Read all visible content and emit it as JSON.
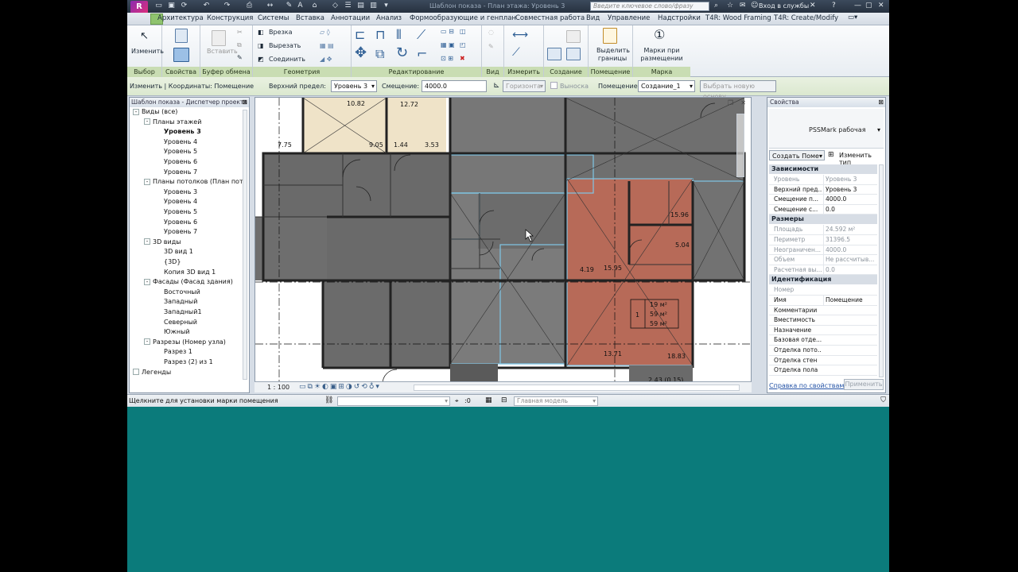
{
  "title_bar": {
    "document_title": "Шаблон показа - План этажа: Уровень 3",
    "search_placeholder": "Введите ключевое слово/фразу",
    "login_label": "Вход в службы"
  },
  "menu_tabs": [
    "Архитектура",
    "Конструкция",
    "Системы",
    "Вставка",
    "Аннотации",
    "Анализ",
    "Формообразующие и генплан",
    "Совместная работа",
    "Вид",
    "Управление",
    "Надстройки",
    "T4R: Wood Framing",
    "T4R: Create/Modify"
  ],
  "ribbon": {
    "panels": {
      "select": "Выбор",
      "properties": "Свойства",
      "clipboard": "Буфер обмена",
      "geometry": "Геометрия",
      "edit": "Редактирование",
      "view": "Вид",
      "measure": "Измерить",
      "create": "Создание",
      "room": "Помещение",
      "tag": "Марка"
    },
    "buttons": {
      "modify": "Изменить",
      "paste": "Вставить",
      "cut_join": "Врезка",
      "cut": "Вырезать",
      "join": "Соединить",
      "highlight_bounds": "Выделить границы",
      "tags_on_placement": "Марки при размещении"
    }
  },
  "options_bar": {
    "context": "Изменить | Координаты: Помещение",
    "upper_limit_label": "Верхний предел:",
    "upper_limit_value": "Уровень 3",
    "offset_label": "Смещение:",
    "offset_value": "4000.0",
    "orientation_value": "Горизонта",
    "leader_label": "Выноска",
    "room_label": "Помещение:",
    "room_value": "Создание_1",
    "pick_boundary_button": "Выбрать новую основу"
  },
  "project_browser": {
    "title": "Шаблон показа - Диспетчер проекта",
    "items": [
      {
        "label": "Виды (все)",
        "level": 0,
        "toggle": "-",
        "bold": false
      },
      {
        "label": "Планы этажей",
        "level": 1,
        "toggle": "-",
        "bold": false
      },
      {
        "label": "Уровень 3",
        "level": 2,
        "toggle": "",
        "bold": true
      },
      {
        "label": "Уровень 4",
        "level": 2,
        "toggle": "",
        "bold": false
      },
      {
        "label": "Уровень 5",
        "level": 2,
        "toggle": "",
        "bold": false
      },
      {
        "label": "Уровень 6",
        "level": 2,
        "toggle": "",
        "bold": false
      },
      {
        "label": "Уровень 7",
        "level": 2,
        "toggle": "",
        "bold": false
      },
      {
        "label": "Планы потолков (План пот",
        "level": 1,
        "toggle": "-",
        "bold": false
      },
      {
        "label": "Уровень 3",
        "level": 2,
        "toggle": "",
        "bold": false
      },
      {
        "label": "Уровень 4",
        "level": 2,
        "toggle": "",
        "bold": false
      },
      {
        "label": "Уровень 5",
        "level": 2,
        "toggle": "",
        "bold": false
      },
      {
        "label": "Уровень 6",
        "level": 2,
        "toggle": "",
        "bold": false
      },
      {
        "label": "Уровень 7",
        "level": 2,
        "toggle": "",
        "bold": false
      },
      {
        "label": "3D виды",
        "level": 1,
        "toggle": "-",
        "bold": false
      },
      {
        "label": "3D вид 1",
        "level": 2,
        "toggle": "",
        "bold": false
      },
      {
        "label": "{3D}",
        "level": 2,
        "toggle": "",
        "bold": false
      },
      {
        "label": "Копия 3D вид 1",
        "level": 2,
        "toggle": "",
        "bold": false
      },
      {
        "label": "Фасады (Фасад здания)",
        "level": 1,
        "toggle": "-",
        "bold": false
      },
      {
        "label": "Восточный",
        "level": 2,
        "toggle": "",
        "bold": false
      },
      {
        "label": "Западный",
        "level": 2,
        "toggle": "",
        "bold": false
      },
      {
        "label": "Западный1",
        "level": 2,
        "toggle": "",
        "bold": false
      },
      {
        "label": "Северный",
        "level": 2,
        "toggle": "",
        "bold": false
      },
      {
        "label": "Южный",
        "level": 2,
        "toggle": "",
        "bold": false
      },
      {
        "label": "Разрезы (Номер узла)",
        "level": 1,
        "toggle": "-",
        "bold": false
      },
      {
        "label": "Разрез 1",
        "level": 2,
        "toggle": "",
        "bold": false
      },
      {
        "label": "Разрез (2) из 1",
        "level": 2,
        "toggle": "",
        "bold": false
      },
      {
        "label": "Легенды",
        "level": 0,
        "toggle": "",
        "bold": false
      }
    ]
  },
  "drawing": {
    "scale": "1 : 100",
    "room_areas": [
      "10.82",
      "12.72",
      "7.75",
      "9.05",
      "1.44",
      "3.53",
      "15.96",
      "5.04",
      "4.19",
      "15.95",
      "13.71",
      "18.83",
      "2.43 (0.15)"
    ],
    "room_tag": {
      "number": "1",
      "line1": "19 м²",
      "line2": "59 м²",
      "line3": "59 м²"
    }
  },
  "properties": {
    "title": "Свойства",
    "type_name": "PSSMark рабочая",
    "create_type_button": "Создать Поме",
    "edit_type_button": "Изменить тип",
    "groups": [
      {
        "name": "Зависимости",
        "rows": [
          {
            "key": "Уровень",
            "value": "Уровень 3",
            "dim": true
          },
          {
            "key": "Верхний пред...",
            "value": "Уровень 3",
            "dim": false
          },
          {
            "key": "Смещение п...",
            "value": "4000.0",
            "dim": false
          },
          {
            "key": "Смещение с...",
            "value": "0.0",
            "dim": false
          }
        ]
      },
      {
        "name": "Размеры",
        "rows": [
          {
            "key": "Площадь",
            "value": "24.592 м²",
            "dim": true
          },
          {
            "key": "Периметр",
            "value": "31396.5",
            "dim": true
          },
          {
            "key": "Неограничен...",
            "value": "4000.0",
            "dim": true
          },
          {
            "key": "Объем",
            "value": "Не рассчитыв...",
            "dim": true
          },
          {
            "key": "Расчетная вы...",
            "value": "0.0",
            "dim": true
          }
        ]
      },
      {
        "name": "Идентификация",
        "rows": [
          {
            "key": "Номер",
            "value": "",
            "dim": true
          },
          {
            "key": "Имя",
            "value": "Помещение",
            "dim": false
          },
          {
            "key": "Комментарии",
            "value": "",
            "dim": false
          },
          {
            "key": "Вместимость",
            "value": "",
            "dim": false
          },
          {
            "key": "Назначение",
            "value": "",
            "dim": false
          },
          {
            "key": "Базовая отде...",
            "value": "",
            "dim": false
          },
          {
            "key": "Отделка пото...",
            "value": "",
            "dim": false
          },
          {
            "key": "Отделка стен",
            "value": "",
            "dim": false
          },
          {
            "key": "Отделка пола",
            "value": "",
            "dim": false
          }
        ]
      }
    ],
    "help_link": "Справка по свойствам",
    "apply_button": "Применить"
  },
  "status_bar": {
    "message": "Щелкните для установки марки помещения",
    "selection_count": ":0",
    "model_label": "Главная модель"
  },
  "colors": {
    "room_highlight": "#b76a58",
    "room_fill": "#6b6b6b",
    "options_bar_bg": "#dbe8cf",
    "background_teal": "#0b7b7b"
  }
}
